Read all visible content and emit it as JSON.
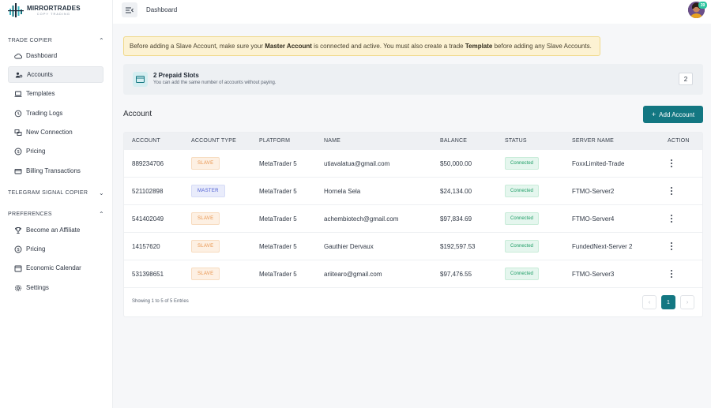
{
  "brand": {
    "title": "MIRRORTRADES",
    "subtitle": "COPY TRADING"
  },
  "header": {
    "breadcrumb": "Dashboard",
    "avatar_badge": "39"
  },
  "sidebar": {
    "trade_copier": {
      "title": "TRADE COPIER",
      "items": [
        {
          "label": "Dashboard",
          "icon": "cloud-icon"
        },
        {
          "label": "Accounts",
          "icon": "users-icon",
          "active": true
        },
        {
          "label": "Templates",
          "icon": "laptop-icon"
        },
        {
          "label": "Trading Logs",
          "icon": "history-icon"
        },
        {
          "label": "New Connection",
          "icon": "link-icon"
        },
        {
          "label": "Pricing",
          "icon": "dollar-icon"
        },
        {
          "label": "Billing Transactions",
          "icon": "wallet-icon"
        }
      ]
    },
    "telegram": {
      "title": "TELEGRAM SIGNAL COPIER"
    },
    "preferences": {
      "title": "PREFERENCES",
      "items": [
        {
          "label": "Become an Affiliate",
          "icon": "trophy-icon"
        },
        {
          "label": "Pricing",
          "icon": "dollar-icon"
        },
        {
          "label": "Economic Calendar",
          "icon": "calendar-icon"
        },
        {
          "label": "Settings",
          "icon": "gear-icon"
        }
      ]
    }
  },
  "alert": {
    "part1": "Before adding a Slave Account, make sure your ",
    "bold1": "Master Account",
    "part2": " is connected and active. You must also create a trade ",
    "bold2": "Template",
    "part3": " before adding any Slave Accounts."
  },
  "slots": {
    "title": "2 Prepaid Slots",
    "subtitle": "You can add the same number of accounts without paying.",
    "count": "2"
  },
  "accounts": {
    "heading": "Account",
    "add_label": "Add Account",
    "columns": [
      "ACCOUNT",
      "ACCOUNT TYPE",
      "PLATFORM",
      "NAME",
      "BALANCE",
      "STATUS",
      "SERVER NAME",
      "ACTION"
    ],
    "rows": [
      {
        "account": "889234706",
        "type": "SLAVE",
        "platform": "MetaTrader 5",
        "name": "utiavalatua@gmail.com",
        "balance": "$50,000.00",
        "status": "Connected",
        "server": "FoxxLimited-Trade"
      },
      {
        "account": "521102898",
        "type": "MASTER",
        "platform": "MetaTrader 5",
        "name": "Hornela Sela",
        "balance": "$24,134.00",
        "status": "Connected",
        "server": "FTMO-Server2"
      },
      {
        "account": "541402049",
        "type": "SLAVE",
        "platform": "MetaTrader 5",
        "name": "achembiotech@gmail.com",
        "balance": "$97,834.69",
        "status": "Connected",
        "server": "FTMO-Server4"
      },
      {
        "account": "14157620",
        "type": "SLAVE",
        "platform": "MetaTrader 5",
        "name": "Gauthier Dervaux",
        "balance": "$192,597.53",
        "status": "Connected",
        "server": "FundedNext-Server 2"
      },
      {
        "account": "531398651",
        "type": "SLAVE",
        "platform": "MetaTrader 5",
        "name": "ariitearo@gmail.com",
        "balance": "$97,476.55",
        "status": "Connected",
        "server": "FTMO-Server3"
      }
    ],
    "showing": "Showing 1 to 5 of 5 Entries",
    "pagination": {
      "prev": "‹",
      "current": "1",
      "next": "›"
    }
  },
  "colors": {
    "accent": "#137782",
    "alert_bg": "#fcf2d3",
    "connected": "#1e9d66",
    "slave": "#e8924a",
    "master": "#4b5bd3"
  }
}
